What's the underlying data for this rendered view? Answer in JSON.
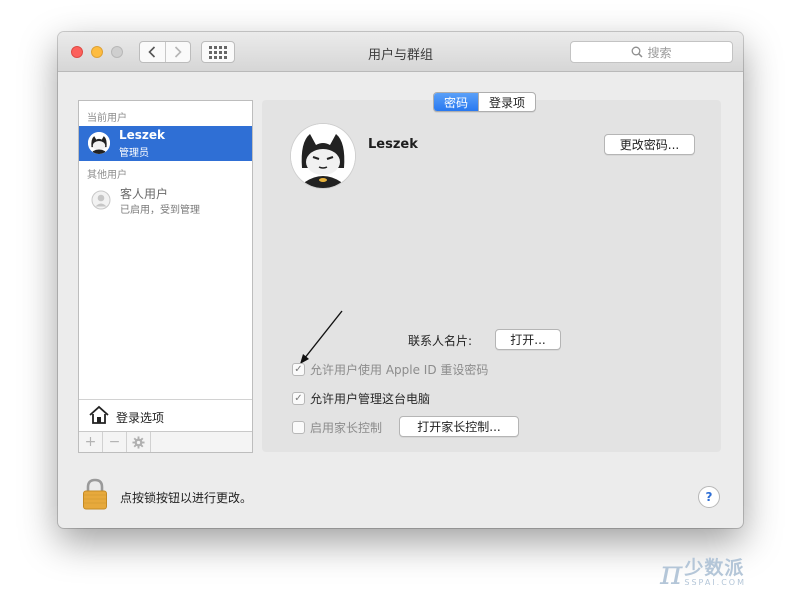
{
  "window": {
    "title": "用户与群组"
  },
  "toolbar": {
    "search_placeholder": "搜索"
  },
  "sidebar": {
    "current_users_label": "当前用户",
    "current_user": {
      "name": "Leszek",
      "role": "管理员"
    },
    "other_users_label": "其他用户",
    "guest_user": {
      "name": "客人用户",
      "status": "已启用，受到管理"
    },
    "login_options_label": "登录选项",
    "bottom_buttons": {
      "add": "+",
      "remove": "−"
    }
  },
  "tabs": [
    {
      "label": "密码",
      "active": true
    },
    {
      "label": "登录项",
      "active": false
    }
  ],
  "user_panel": {
    "name": "Leszek",
    "change_password_button": "更改密码...",
    "contact_card_label": "联系人名片:",
    "open_button": "打开...",
    "options": [
      {
        "label": "允许用户使用 Apple ID 重设密码",
        "checked": true,
        "enabled": false
      },
      {
        "label": "允许用户管理这台电脑",
        "checked": true,
        "enabled": true
      },
      {
        "label": "启用家长控制",
        "checked": false,
        "enabled": false
      }
    ],
    "parental_controls_button": "打开家长控制..."
  },
  "footer": {
    "lock_text": "点按锁按钮以进行更改。",
    "help_label": "?"
  },
  "watermark": {
    "name": "少数派",
    "domain": "SSPAI.COM"
  },
  "colors": {
    "accent": "#2f6fd5",
    "close": "#fc605c",
    "minimize": "#fdbc40",
    "lock": "#e7a93c"
  }
}
